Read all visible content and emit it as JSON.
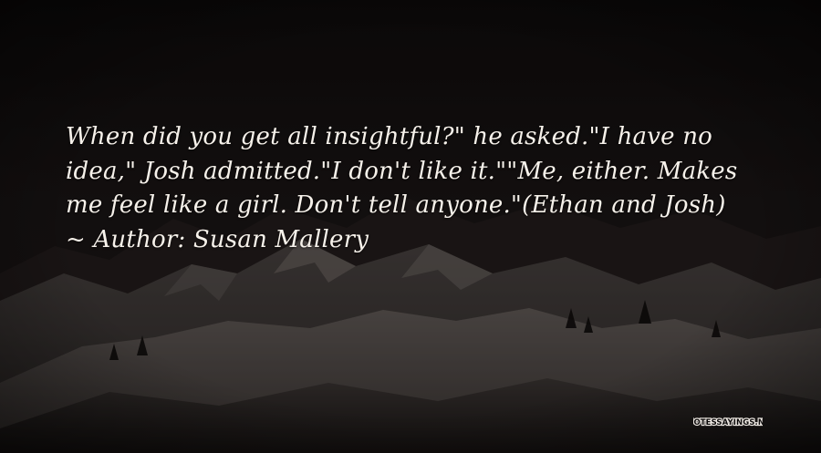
{
  "quote": {
    "text": "When did you get all insightful?\" he asked.\"I have no idea,\" Josh admitted.\"I don't like it.\"\"Me, either. Makes me feel like a girl. Don't tell anyone.\"(Ethan and Josh)",
    "author_prefix": "~ Author: ",
    "author_name": "Susan Mallery"
  },
  "watermark": {
    "text": "QUOTESSAYINGS.NET"
  },
  "colors": {
    "text": "#f6f1ea",
    "background_dark": "#120f0f",
    "snow": "#5a5452"
  }
}
